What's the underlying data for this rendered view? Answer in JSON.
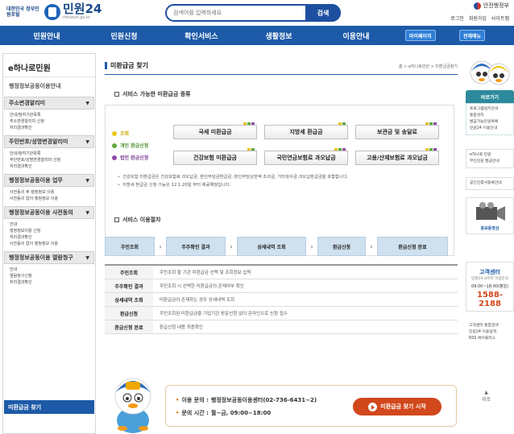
{
  "header": {
    "logo_small": "대한민국 정부민원포털",
    "logo_main": "민원24",
    "logo_sub": "minwon.go.kr",
    "search_placeholder": "검색어를 입력하세요",
    "search_button": "검색",
    "gov_logo": "안전행정부",
    "util_links": [
      "로그인",
      "회원가입",
      "사이트맵"
    ]
  },
  "nav": {
    "items": [
      "민원안내",
      "민원신청",
      "확인서비스",
      "생활정보",
      "이용안내"
    ],
    "mypage": "마이페이지",
    "allmenu": "전체메뉴"
  },
  "sidebar": {
    "title": "e하나로민원",
    "subtitle": "행정정보공동이용안내",
    "groups": [
      {
        "label": "주소변경알리미",
        "links": [
          "안내/참여기관목록",
          "주소변경알리미 신청",
          "처리결과확인"
        ]
      },
      {
        "label": "주민번호/성명변경알리미",
        "links": [
          "안내/참여기관목록",
          "주민번호/성명변경알리미 신청",
          "처리결과확인"
        ]
      },
      {
        "label": "행정정보공동이용 업무",
        "links": [
          "사전동의 후 행정정보 이용",
          "사전동의 없이 행정정보 이용"
        ]
      },
      {
        "label": "행정정보공동이용 사전동의",
        "links": [
          "안내",
          "행정정보이용 신청",
          "처리결과확인",
          "사전동의 없이 행정정보 이용"
        ]
      },
      {
        "label": "행정정보공동이용 열람청구",
        "links": [
          "안내",
          "열람청구신청",
          "처리결과확인"
        ]
      }
    ],
    "active": "미환급금 찾기"
  },
  "main": {
    "title": "미환급금 찾기",
    "breadcrumb": "홈 > e하나로민원 > 미환급금찾기",
    "section1": "서비스 가능한 미환급금 종류",
    "legend": [
      "조회",
      "개인 환급신청",
      "법인 환급신청"
    ],
    "legend_colors": [
      "#e8c51a",
      "#5ea83c",
      "#8e4aa8"
    ],
    "buttons": [
      "국세 미환급금",
      "지방세 환급금",
      "보관금 및 송달료",
      "건강보험 미환급금",
      "국민연금보험료 과오납금",
      "고용/산재보험료 과오납금"
    ],
    "notes": [
      "건강보험 미환급금은 건강보험료 과오납금, 본인부담금환급금, 본인부담상한액 초과금, 기타징수금 과오납환급금을 포함합니다.",
      "지방세 환급금 신청 가능은 12.1.20일 부터 제공예정입니다."
    ],
    "section2": "서비스 이용절차",
    "steps": [
      "주민조회",
      "주주확인 결과",
      "상세내역 조회",
      "환급신청",
      "환급신청 완료"
    ],
    "table": [
      {
        "k": "주민조회",
        "v": "주민조회 할 기관 미환급금 선택 및 조회정보 입력"
      },
      {
        "k": "주주확인 결과",
        "v": "주민조회 시 선택한 미환급금의 존재여부 확인"
      },
      {
        "k": "상세내역 조회",
        "v": "미환급금이 존재하는 경우 상세내역 조회"
      },
      {
        "k": "환급신청",
        "v": "주민조회된 미환급금을 기업기관 방문신청 없이 온라인으로 신청 접수"
      },
      {
        "k": "환급신청 완료",
        "v": "환급신청 내용 최종확인"
      }
    ],
    "contact_label": "이용 문의 :",
    "contact_value": "행정정보공동이용센터(02-736-6431~2)",
    "hours_label": "문의 시간 :",
    "hours_value": "월~금, 09:00~18:00",
    "start_button": "미환급금 찾기 시작"
  },
  "right": {
    "shortcut": "바로가기",
    "shortcut_links": [
      "프로그램설치안내",
      "통합성지",
      "발급가능민원목록",
      "민원24 이용안내"
    ],
    "links2": [
      "e하나로 민원",
      "무인민원 발급안내"
    ],
    "links3": [
      "공인인증서등록안내"
    ],
    "promo": "홍보동영상",
    "call_title": "고객센터",
    "call_sub": "민원24 사이트 이용문의",
    "call_hours": "09:00~18:00(평일)",
    "call_number": "1588-2188",
    "links4": [
      "고객센터 통합검색",
      "민원24 이용실적",
      "RSS 에이플러스"
    ],
    "top": "위로"
  }
}
